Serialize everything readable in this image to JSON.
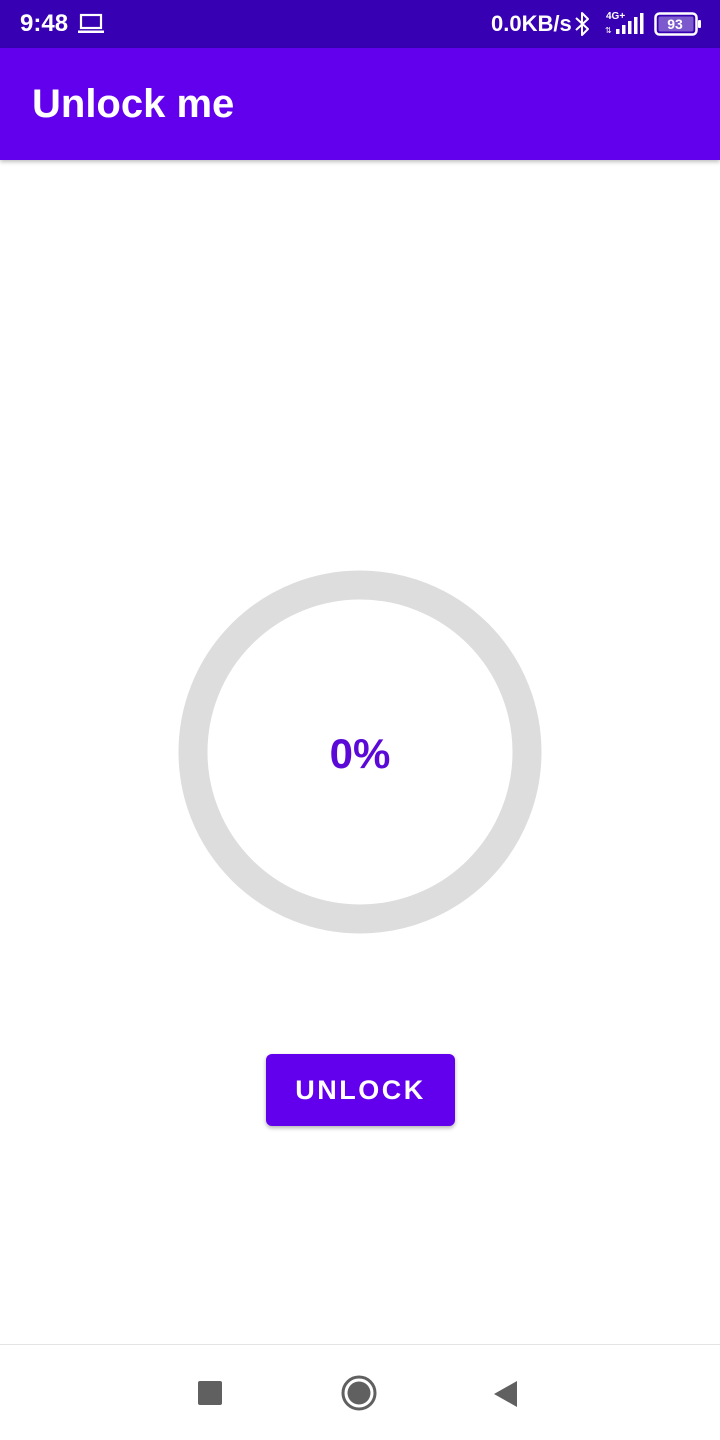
{
  "status_bar": {
    "time": "9:48",
    "net_speed": "0.0KB/s",
    "network_type": "4G+",
    "battery_level": "93",
    "icons": [
      "laptop-icon",
      "bluetooth-icon",
      "signal-icon",
      "battery-icon"
    ],
    "background": "#3700b3"
  },
  "app_bar": {
    "title": "Unlock me",
    "background": "#6200ee"
  },
  "progress": {
    "value": 0,
    "label": "0%",
    "track_color": "#dddddd",
    "text_color": "#5b09d6"
  },
  "unlock_button": {
    "label": "UNLOCK",
    "background": "#6200ee"
  },
  "nav_bar": {
    "icons": [
      "recents-icon",
      "home-icon",
      "back-icon"
    ]
  }
}
